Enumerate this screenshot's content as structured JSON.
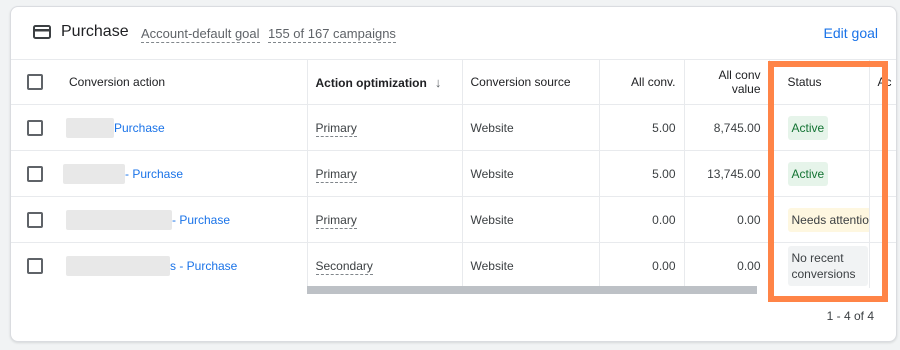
{
  "goal": {
    "title": "Purchase",
    "icon": "credit-card-icon",
    "type_label": "Account-default goal",
    "campaigns_label": "155 of 167 campaigns",
    "edit_label": "Edit goal"
  },
  "table": {
    "headers": {
      "conversion_action": "Conversion action",
      "action_optimization": "Action optimization",
      "conversion_source": "Conversion source",
      "all_conv": "All conv.",
      "all_conv_value_line1": "All conv",
      "all_conv_value_line2": "value",
      "status": "Status",
      "truncated": "Ac"
    },
    "rows": [
      {
        "name_suffix": "Purchase",
        "optimization": "Primary",
        "source": "Website",
        "all_conv": "5.00",
        "all_conv_value": "8,745.00",
        "status": "Active"
      },
      {
        "name_suffix": "- Purchase",
        "optimization": "Primary",
        "source": "Website",
        "all_conv": "5.00",
        "all_conv_value": "13,745.00",
        "status": "Active"
      },
      {
        "name_suffix": "- Purchase",
        "optimization": "Primary",
        "source": "Website",
        "all_conv": "0.00",
        "all_conv_value": "0.00",
        "status": "Needs attention"
      },
      {
        "name_suffix": "s - Purchase",
        "optimization": "Secondary",
        "source": "Website",
        "all_conv": "0.00",
        "all_conv_value": "0.00",
        "status": "No recent conversions"
      }
    ]
  },
  "pagination": "1 - 4 of 4",
  "colors": {
    "accent": "#1a73e8",
    "highlight": "#ff8447",
    "active_bg": "#e6f4ea",
    "warn_bg": "#fef7e0"
  }
}
